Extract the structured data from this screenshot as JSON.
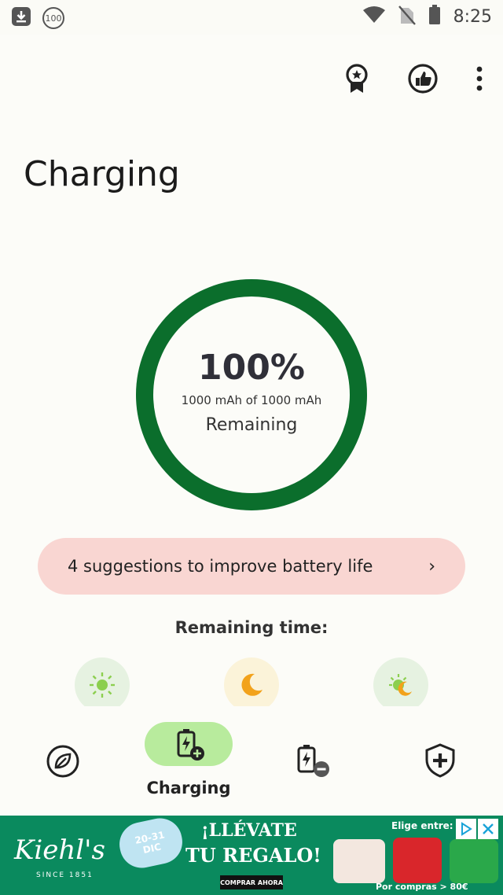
{
  "status_bar": {
    "badge_count": "100",
    "time": "8:25"
  },
  "page": {
    "title": "Charging"
  },
  "battery": {
    "percent_text": "100%",
    "capacity_text": "1000 mAh of 1000 mAh",
    "state_text": "Remaining",
    "level": 1.0,
    "ring_color": "#0b6e2c"
  },
  "suggestion": {
    "text": "4 suggestions to improve battery life",
    "chevron": "›"
  },
  "remaining": {
    "title": "Remaining time:",
    "modes": [
      {
        "icon": "sun-icon",
        "bg": "#e6f2e1"
      },
      {
        "icon": "moon-icon",
        "bg": "#fbf3d9"
      },
      {
        "icon": "sun-moon-icon",
        "bg": "#e6f2e1"
      }
    ]
  },
  "nav": {
    "items": [
      {
        "icon": "leaf-icon",
        "label": ""
      },
      {
        "icon": "battery-charging-plus-icon",
        "label": "Charging",
        "active": true
      },
      {
        "icon": "battery-minus-icon",
        "label": ""
      },
      {
        "icon": "shield-plus-icon",
        "label": ""
      }
    ]
  },
  "ad": {
    "brand": "Kiehl's",
    "since": "SINCE 1851",
    "date_line1": "20-31",
    "date_line2": "DIC",
    "headline1": "¡LLÉVATE",
    "headline2": "TU REGALO!",
    "cta": "COMPRAR AHORA",
    "elige": "Elige entre:",
    "por": "Por compras > 80€"
  }
}
